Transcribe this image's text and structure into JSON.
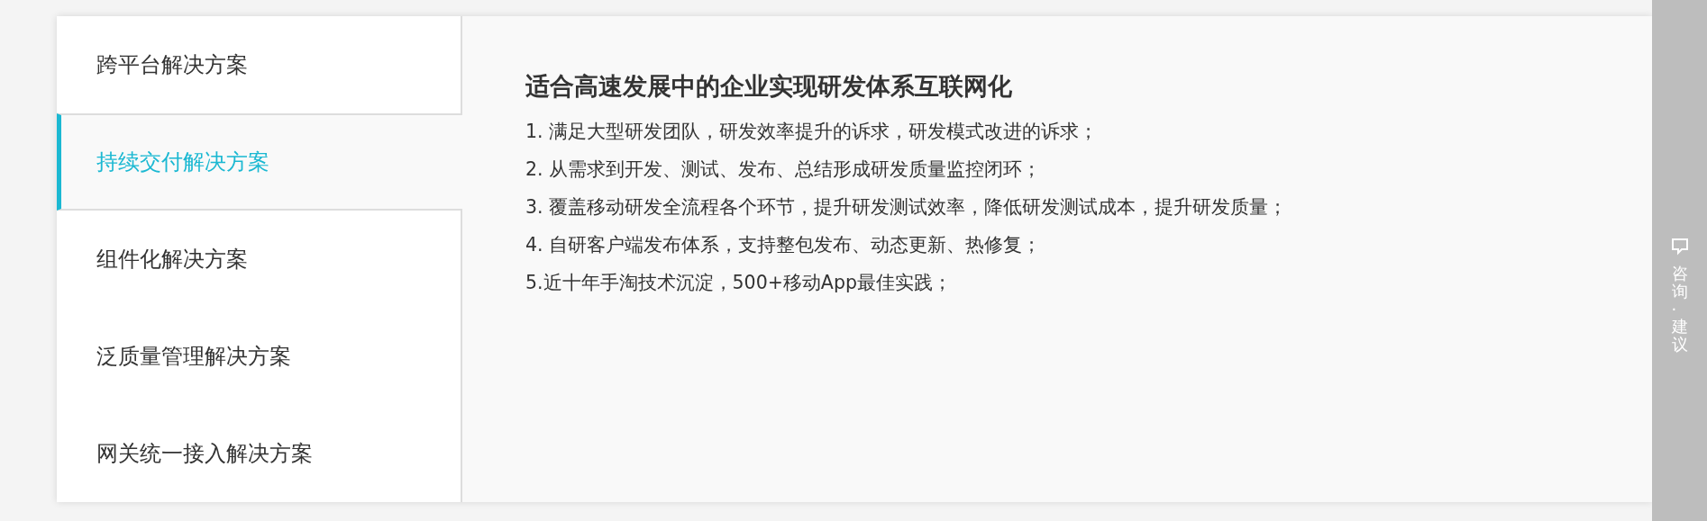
{
  "tabs": [
    {
      "label": "跨平台解决方案",
      "selected": false
    },
    {
      "label": "持续交付解决方案",
      "selected": true
    },
    {
      "label": "组件化解决方案",
      "selected": false
    },
    {
      "label": "泛质量管理解决方案",
      "selected": false
    },
    {
      "label": "网关统一接入解决方案",
      "selected": false
    }
  ],
  "panel": {
    "title": "适合高速发展中的企业实现研发体系互联网化",
    "points": [
      "1. 满足大型研发团队，研发效率提升的诉求，研发模式改进的诉求；",
      "2. 从需求到开发、测试、发布、总结形成研发质量监控闭环；",
      "3. 覆盖移动研发全流程各个环节，提升研发测试效率，降低研发测试成本，提升研发质量；",
      "4. 自研客户端发布体系，支持整包发布、动态更新、热修复；",
      "5.近十年手淘技术沉淀，500+移动App最佳实践；"
    ]
  },
  "side_widget": {
    "label": "咨询·建议"
  }
}
